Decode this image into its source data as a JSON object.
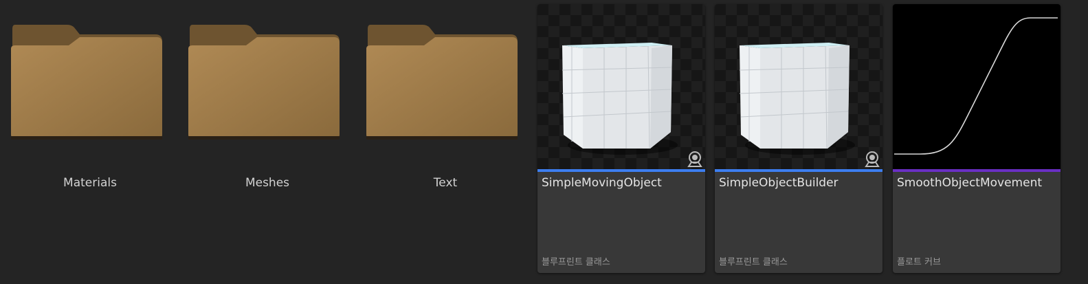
{
  "folders": [
    {
      "label": "Materials",
      "icon": "folder-icon"
    },
    {
      "label": "Meshes",
      "icon": "folder-icon"
    },
    {
      "label": "Text",
      "icon": "folder-icon"
    }
  ],
  "assets": [
    {
      "name": "SimpleMovingObject",
      "type": "블루프린트 클래스",
      "thumbnail": "cube-icon",
      "type_color": "#3d7ef0"
    },
    {
      "name": "SimpleObjectBuilder",
      "type": "블루프린트 클래스",
      "thumbnail": "cube-icon",
      "type_color": "#3d7ef0"
    },
    {
      "name": "SmoothObjectMovement",
      "type": "플로트 커브",
      "thumbnail": "curve-icon",
      "type_color": "#6a2fc4"
    }
  ],
  "colors": {
    "background": "#242424",
    "tile": "#383838",
    "folder": "#a8844e",
    "blueprint_accent": "#3d7ef0",
    "curve_accent": "#6a2fc4"
  }
}
